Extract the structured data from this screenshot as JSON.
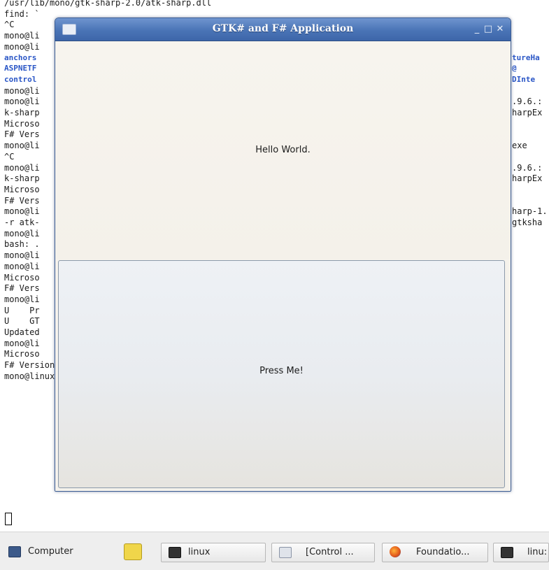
{
  "terminal": {
    "lines": [
      {
        "text": "/usr/lib/mono/gtk-sharp-2.0/atk-sharp.dll",
        "style": "normal"
      },
      {
        "text": "find: `",
        "style": "normal"
      },
      {
        "text": "^C",
        "style": "normal"
      },
      {
        "text": "mono@li",
        "style": "normal"
      },
      {
        "text": "mono@li",
        "style": "normal"
      },
      {
        "text": "anchors",
        "style": "blue",
        "right": "tureHa"
      },
      {
        "text": "ASPNETF",
        "style": "blue",
        "right": "@"
      },
      {
        "text": "control",
        "style": "blue",
        "right": "DInte"
      },
      {
        "text": "mono@li",
        "style": "normal"
      },
      {
        "text": "mono@li",
        "style": "normal",
        "right": ".9.6.:"
      },
      {
        "text": "k-sharp",
        "style": "normal",
        "right": "harpEx"
      },
      {
        "text": "Microso",
        "style": "normal"
      },
      {
        "text": "F# Vers",
        "style": "normal"
      },
      {
        "text": "mono@li",
        "style": "normal",
        "right": "exe"
      },
      {
        "text": "^C",
        "style": "normal"
      },
      {
        "text": "mono@li",
        "style": "normal",
        "right": ".9.6.:"
      },
      {
        "text": "k-sharp",
        "style": "normal",
        "right": "harpEx"
      },
      {
        "text": "Microso",
        "style": "normal"
      },
      {
        "text": "F# Vers",
        "style": "normal"
      },
      {
        "text": "mono@li",
        "style": "normal",
        "right": "harp-1."
      },
      {
        "text": "-r atk-",
        "style": "normal",
        "right": "gtksha"
      },
      {
        "text": "mono@li",
        "style": "normal"
      },
      {
        "text": "bash: .",
        "style": "normal"
      },
      {
        "text": "mono@li",
        "style": "normal"
      },
      {
        "text": "mono@li",
        "style": "normal"
      },
      {
        "text": "Microso",
        "style": "normal"
      },
      {
        "text": "F# Vers",
        "style": "normal"
      },
      {
        "text": "mono@li",
        "style": "normal"
      },
      {
        "text": "U    Pr",
        "style": "normal"
      },
      {
        "text": "U    GT",
        "style": "normal"
      },
      {
        "text": "Updated",
        "style": "normal"
      },
      {
        "text": "mono@li",
        "style": "normal"
      },
      {
        "text": "Microso",
        "style": "normal"
      },
      {
        "text": "F# Version 2.0.0.0, compiling for .NET Framework Version v2.0.50727",
        "style": "normal"
      },
      {
        "text": "mono@linux:~/fofs/SecondEdition/Chapter08/GTKSharp> mono ./gtksharpExample.exe",
        "style": "normal"
      }
    ]
  },
  "window": {
    "title": "GTK# and F# Application",
    "label_text": "Hello World.",
    "button_label": "Press Me!",
    "controls": {
      "minimize": "_",
      "maximize": "□",
      "close": "✕"
    }
  },
  "taskbar": {
    "items": [
      {
        "label": "Computer",
        "icon": "computer-icon",
        "boxed": false
      },
      {
        "label": "",
        "icon": "notes-icon",
        "boxed": false
      },
      {
        "label": "linux",
        "icon": "terminal-icon",
        "boxed": true
      },
      {
        "label": "[Control ...",
        "icon": "control-panel-icon",
        "boxed": true
      },
      {
        "label": "Foundatio...",
        "icon": "firefox-icon",
        "boxed": true
      },
      {
        "label": "linu:",
        "icon": "terminal-icon",
        "boxed": true
      }
    ]
  },
  "colors": {
    "titlebar": "#4a74b6",
    "terminal_blue": "#2a56c6",
    "window_bg": "#f5f2ec"
  }
}
